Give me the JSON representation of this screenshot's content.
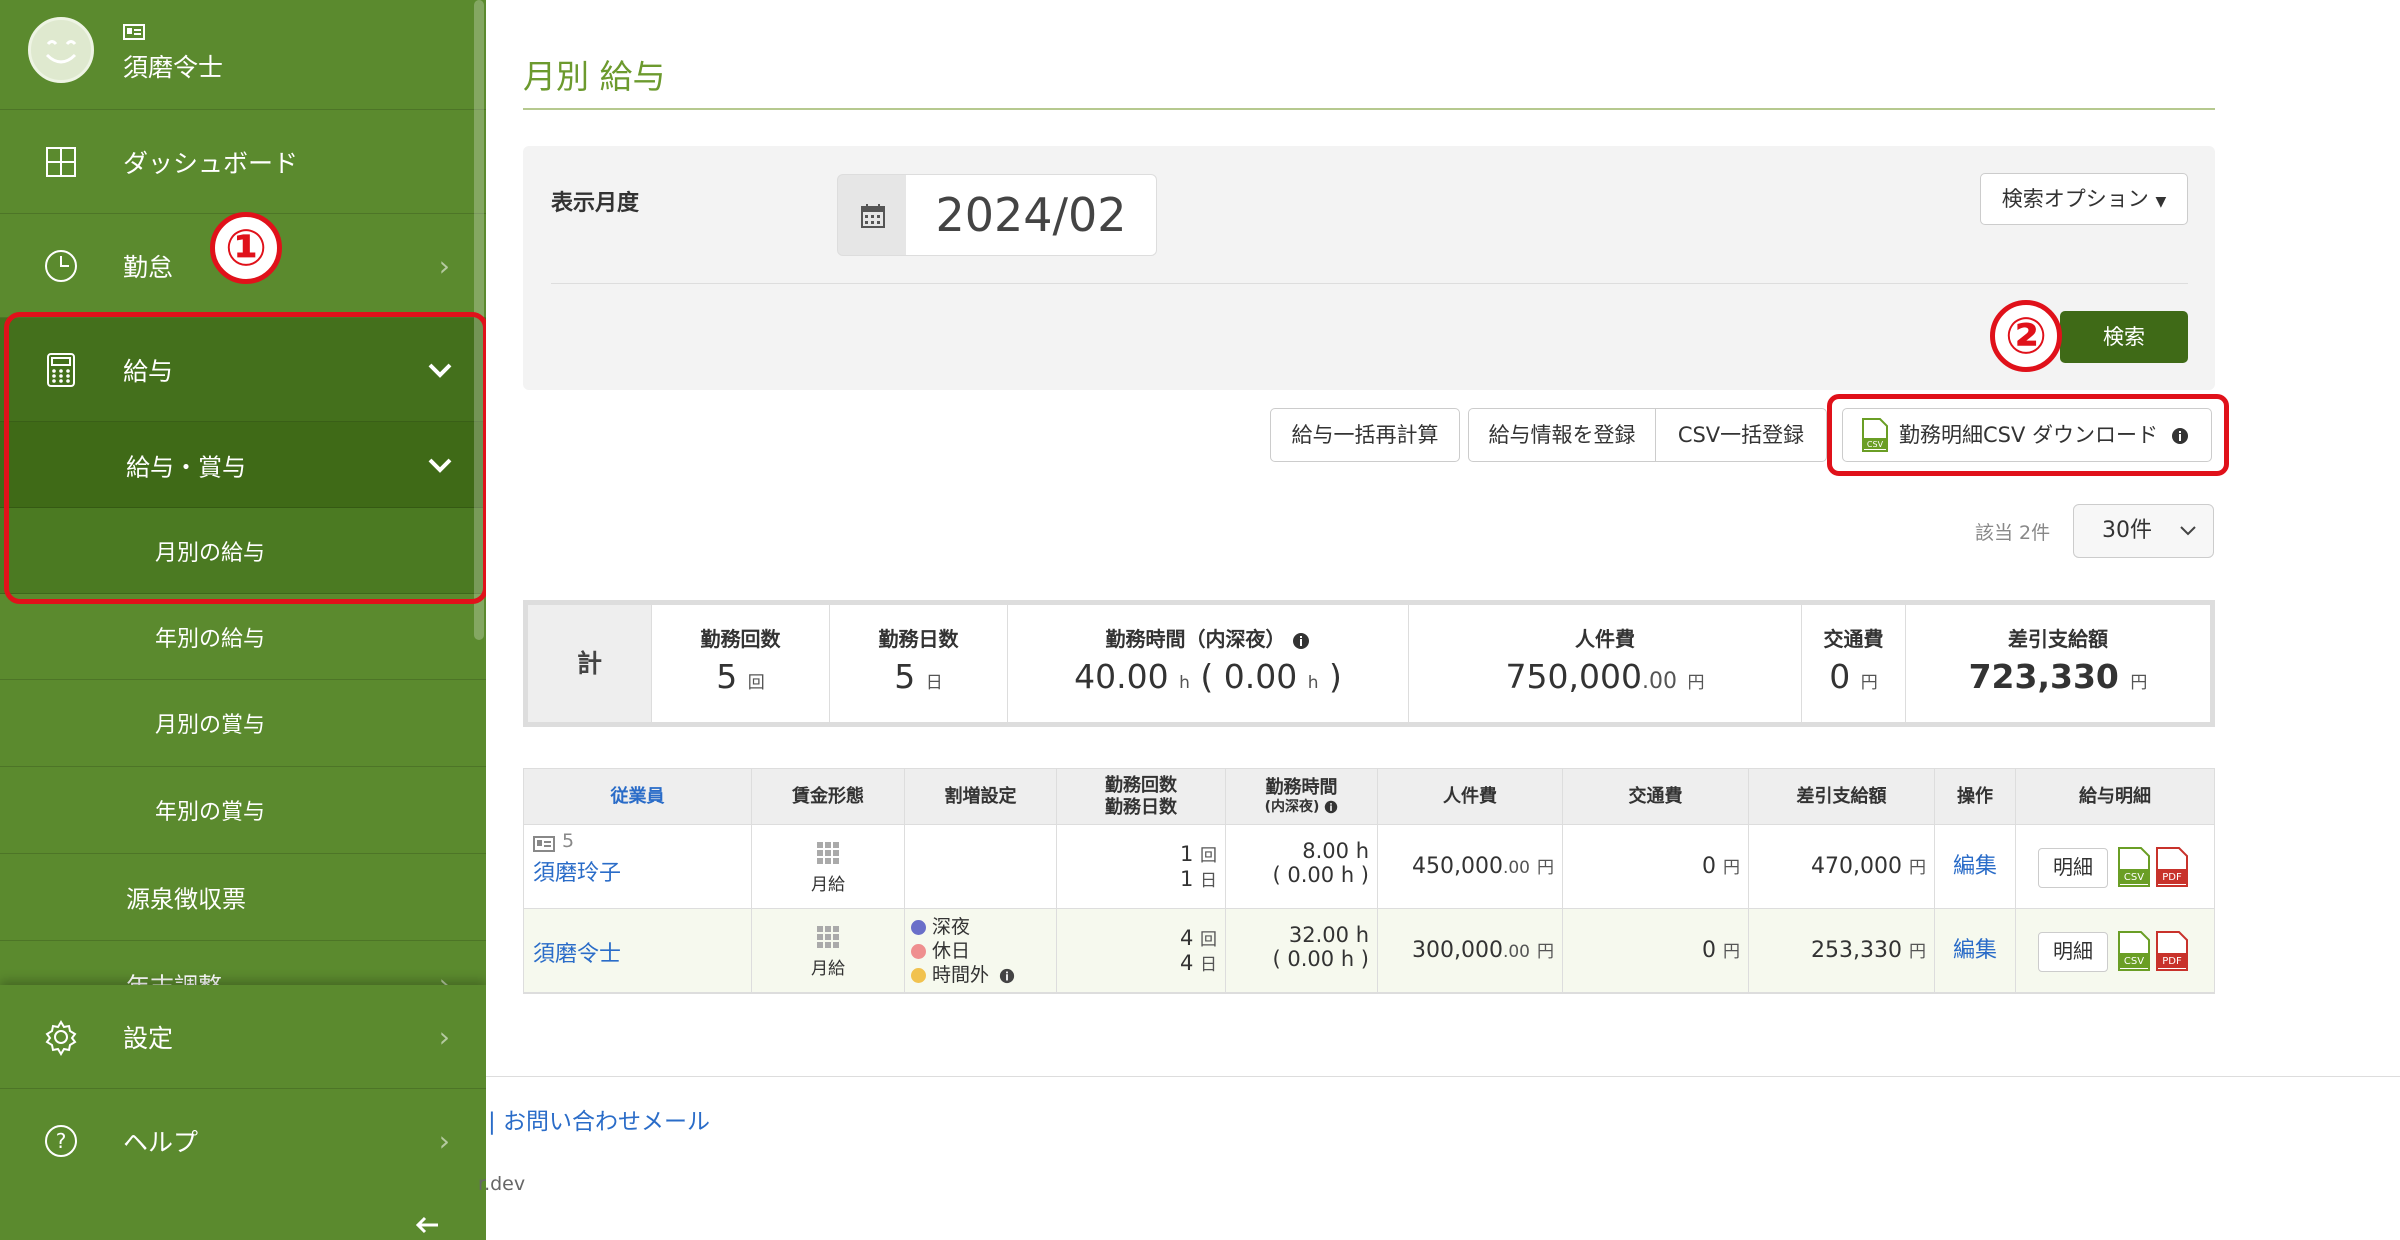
{
  "sidebar": {
    "user_name": "須磨令士",
    "items": [
      {
        "label": "ダッシュボード"
      },
      {
        "label": "勤怠"
      },
      {
        "label": "給与"
      },
      {
        "label": "給与・賞与"
      },
      {
        "label": "月別の給与"
      },
      {
        "label": "年別の給与"
      },
      {
        "label": "月別の賞与"
      },
      {
        "label": "年別の賞与"
      },
      {
        "label": "源泉徴収票"
      },
      {
        "label": "年末調整"
      }
    ],
    "bottom_items": [
      {
        "label": "設定"
      },
      {
        "label": "ヘルプ"
      }
    ],
    "collapse_icon": "arrow-left-icon"
  },
  "annotations": {
    "step1": "①",
    "step2": "②"
  },
  "page": {
    "title": "月別 給与"
  },
  "search": {
    "month_label": "表示月度",
    "month_value": "2024/02",
    "options_label": "検索オプション",
    "search_button": "検索"
  },
  "actions": {
    "recalc": "給与一括再計算",
    "register": "給与情報を登録",
    "csv_import": "CSV一括登録",
    "download": "勤務明細CSV ダウンロード"
  },
  "results": {
    "hits": "該当 2件",
    "per_page": "30件"
  },
  "summary": {
    "label": "計",
    "cols": [
      {
        "header": "勤務回数",
        "value": "5",
        "unit": "回"
      },
      {
        "header": "勤務日数",
        "value": "5",
        "unit": "日"
      },
      {
        "header": "勤務時間（内深夜）",
        "value": "40.00",
        "unit": "h",
        "value2": "0.00",
        "unit2": "h"
      },
      {
        "header": "人件費",
        "value": "750,000",
        "decimal": ".00",
        "unit": "円"
      },
      {
        "header": "交通費",
        "value": "0",
        "unit": "円"
      },
      {
        "header": "差引支給額",
        "value": "723,330",
        "unit": "円"
      }
    ]
  },
  "table": {
    "headers": {
      "employee": "従業員",
      "wage_type": "賃金形態",
      "premium": "割増設定",
      "count1": "勤務回数",
      "count2": "勤務日数",
      "hours1": "勤務時間",
      "hours2": "(内深夜)",
      "cost": "人件費",
      "transport": "交通費",
      "net": "差引支給額",
      "ops": "操作",
      "slip": "給与明細"
    },
    "rows": [
      {
        "emp_id": "5",
        "name": "須磨玲子",
        "wage_type": "月給",
        "premiums": [],
        "count": "1",
        "count_unit": "回",
        "days": "1",
        "days_unit": "日",
        "hours": "8.00",
        "night": "0.00",
        "h_unit": "h",
        "cost": "450,000",
        "cost_dec": ".00",
        "yen": "円",
        "transport": "0",
        "net": "470,000",
        "edit": "編集",
        "slip": "明細"
      },
      {
        "emp_id": "",
        "name": "須磨令士",
        "wage_type": "月給",
        "premiums": [
          {
            "label": "深夜",
            "color": "#6a6fc9"
          },
          {
            "label": "休日",
            "color": "#ef8f8f"
          },
          {
            "label": "時間外",
            "color": "#f1c24f"
          }
        ],
        "count": "4",
        "count_unit": "回",
        "days": "4",
        "days_unit": "日",
        "hours": "32.00",
        "night": "0.00",
        "h_unit": "h",
        "cost": "300,000",
        "cost_dec": ".00",
        "yen": "円",
        "transport": "0",
        "net": "253,330",
        "edit": "編集",
        "slip": "明細"
      }
    ]
  },
  "footer": {
    "contact": "| お問い合わせメール",
    "domain_fragment": "r.dev"
  },
  "colors": {
    "sidebar": "#5b8a2e",
    "accent": "#3f6a17",
    "highlight": "#e0111a",
    "link": "#2a6cc8"
  }
}
